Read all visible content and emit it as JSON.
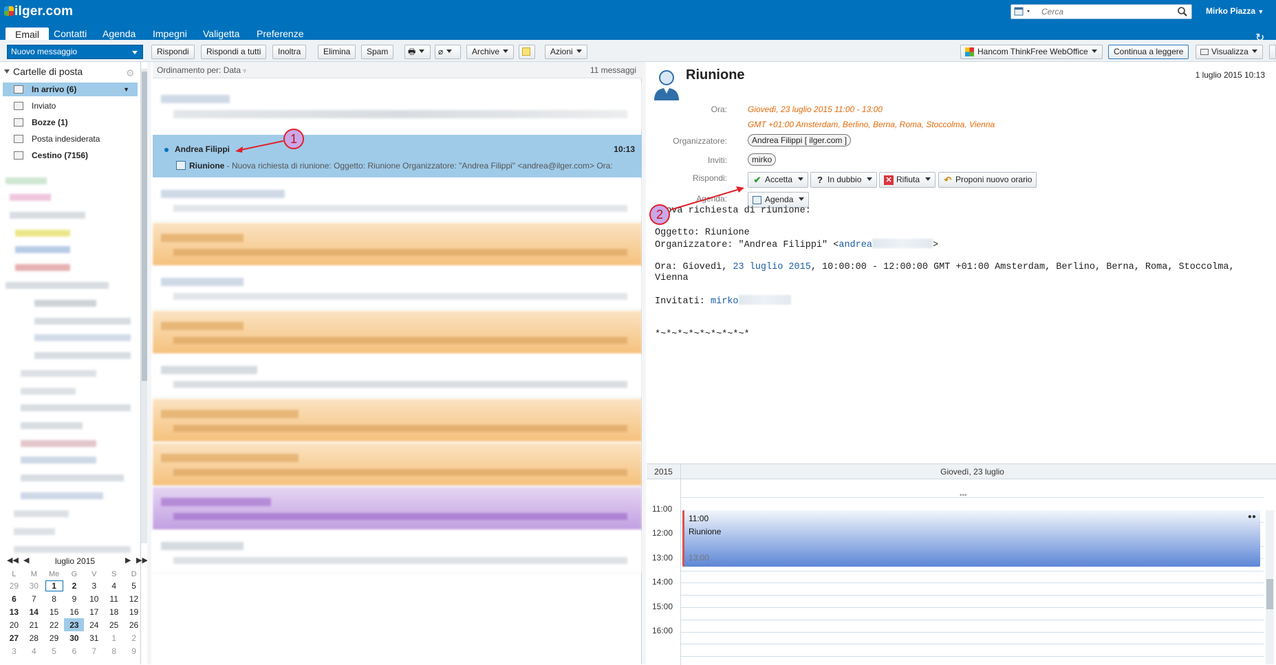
{
  "header": {
    "logo": "ilger.com",
    "search_placeholder": "Cerca",
    "user": "Mirko Piazza"
  },
  "nav": {
    "tabs": [
      "Email",
      "Contatti",
      "Agenda",
      "Impegni",
      "Valigetta",
      "Preferenze"
    ]
  },
  "toolbar": {
    "new_message": "Nuovo messaggio",
    "reply": "Rispondi",
    "reply_all": "Rispondi a tutti",
    "forward": "Inoltra",
    "delete": "Elimina",
    "spam": "Spam",
    "archive": "Archive",
    "actions": "Azioni",
    "weboffice": "Hancom ThinkFree WebOffice",
    "continue_reading": "Continua a leggere",
    "view": "Visualizza"
  },
  "folders": {
    "header": "Cartelle di posta",
    "items": [
      {
        "label": "In arrivo (6)",
        "bold": true
      },
      {
        "label": "Inviato",
        "bold": false
      },
      {
        "label": "Bozze (1)",
        "bold": true
      },
      {
        "label": "Posta indesiderata",
        "bold": false
      },
      {
        "label": "Cestino (7156)",
        "bold": true
      }
    ]
  },
  "mini_calendar": {
    "month": "luglio 2015",
    "weekdays": [
      "L",
      "M",
      "Me",
      "G",
      "V",
      "S",
      "D"
    ],
    "weeks": [
      [
        "29",
        "30",
        "1",
        "2",
        "3",
        "4",
        "5"
      ],
      [
        "6",
        "7",
        "8",
        "9",
        "10",
        "11",
        "12"
      ],
      [
        "13",
        "14",
        "15",
        "16",
        "17",
        "18",
        "19"
      ],
      [
        "20",
        "21",
        "22",
        "23",
        "24",
        "25",
        "26"
      ],
      [
        "27",
        "28",
        "29",
        "30",
        "31",
        "1",
        "2"
      ],
      [
        "3",
        "4",
        "5",
        "6",
        "7",
        "8",
        "9"
      ]
    ]
  },
  "message_list": {
    "sort_label": "Ordinamento per: Data",
    "count": "11 messaggi",
    "selected": {
      "from": "Andrea Filippi",
      "time": "10:13",
      "subject": "Riunione",
      "preview": " - Nuova richiesta di riunione: Oggetto: Riunione Organizzatore: \"Andrea Filippi\" <andrea@ilger.com> Ora:"
    }
  },
  "reader": {
    "title": "Riunione",
    "date": "1 luglio 2015 10:13",
    "time_label": "Ora:",
    "time_value": "Giovedì, 23 luglio 2015 11:00 - 13:00",
    "timezone": "GMT +01:00 Amsterdam, Berlino, Berna, Roma, Stoccolma, Vienna",
    "organizer_label": "Organizzatore:",
    "organizer": "Andrea Filippi [ ilger.com ]",
    "invites_label": "Inviti:",
    "invitee": "mirko",
    "reply_label": "Rispondi:",
    "accept": "Accetta",
    "tentative": "In dubbio",
    "decline": "Rifiuta",
    "propose": "Proponi nuovo orario",
    "agenda_label": "Agenda:",
    "agenda_btn": "Agenda",
    "body": {
      "l1": "Nuova richiesta di riunione:",
      "l2": "Oggetto: Riunione",
      "l3a": "Organizzatore: \"Andrea Filippi\" <",
      "l3b": "andrea",
      "l3c": ">",
      "l4a": "Ora: Giovedì, ",
      "l4b": "23 luglio 2015",
      "l4c": ", 10:00:00 - 12:00:00 GMT +01:00 Amsterdam, Berlino, Berna, Roma, Stoccolma,",
      "l5": "Vienna",
      "l6a": "Invitati: ",
      "l6b": "mirko",
      "l7": "*~*~*~*~*~*~*~*~*"
    }
  },
  "agenda_view": {
    "year": "2015",
    "day": "Giovedì, 23 luglio",
    "times": [
      "11:00",
      "12:00",
      "13:00",
      "14:00",
      "15:00",
      "16:00"
    ],
    "event": {
      "start": "11:00",
      "title": "Riunione",
      "end": "13:00"
    }
  },
  "annotations": [
    "1",
    "2"
  ],
  "colors": {
    "brand": "#0071bc",
    "selection": "#9fcbe9",
    "accent_orange": "#e46a0a"
  }
}
